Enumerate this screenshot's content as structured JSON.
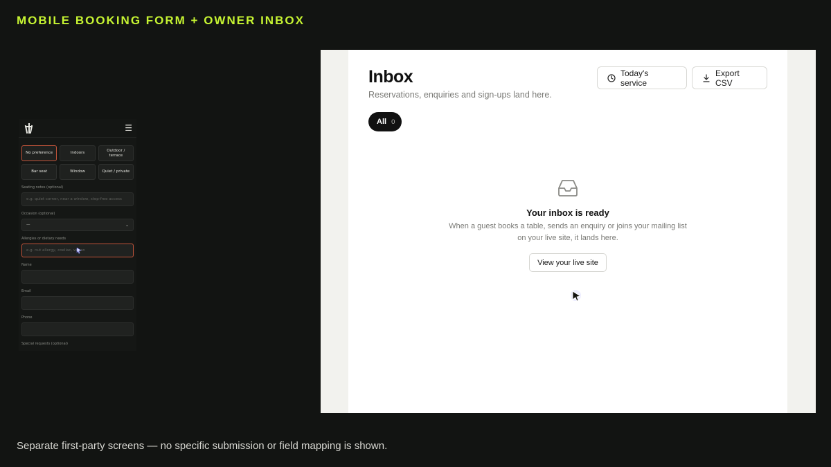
{
  "slide": {
    "title": "MOBILE BOOKING FORM + OWNER INBOX",
    "caption": "Separate first-party screens — no specific submission or field mapping is shown."
  },
  "mobile_form": {
    "menu_icon": "hamburger-icon",
    "logo": "restaurant-logo-icon",
    "seating_options": [
      {
        "label": "No preference",
        "selected": true
      },
      {
        "label": "Indoors",
        "selected": false
      },
      {
        "label": "Outdoor / terrace",
        "selected": false
      },
      {
        "label": "Bar seat",
        "selected": false
      },
      {
        "label": "Window",
        "selected": false
      },
      {
        "label": "Quiet / private",
        "selected": false
      }
    ],
    "seating_notes": {
      "label": "Seating notes (optional)",
      "placeholder": "e.g. quiet corner, near a window, step-free access"
    },
    "occasion": {
      "label": "Occasion (optional)",
      "value": "—"
    },
    "allergies": {
      "label": "Allergies or dietary needs",
      "placeholder": "e.g. nut allergy, coeliac, vegan"
    },
    "name": {
      "label": "Name"
    },
    "email": {
      "label": "Email"
    },
    "phone": {
      "label": "Phone"
    },
    "special_requests": {
      "label": "Special requests (optional)"
    },
    "accent_color": "#c2543a"
  },
  "inbox": {
    "title": "Inbox",
    "subtitle": "Reservations, enquiries and sign-ups land here.",
    "todays_service_label": "Today's service",
    "export_label": "Export CSV",
    "filter": {
      "label": "All",
      "count": "0"
    },
    "empty_state": {
      "icon": "inbox-tray-icon",
      "title": "Your inbox is ready",
      "description": "When a guest books a table, sends an enquiry or joins your mailing list on your live site, it lands here.",
      "button_label": "View your live site"
    }
  }
}
